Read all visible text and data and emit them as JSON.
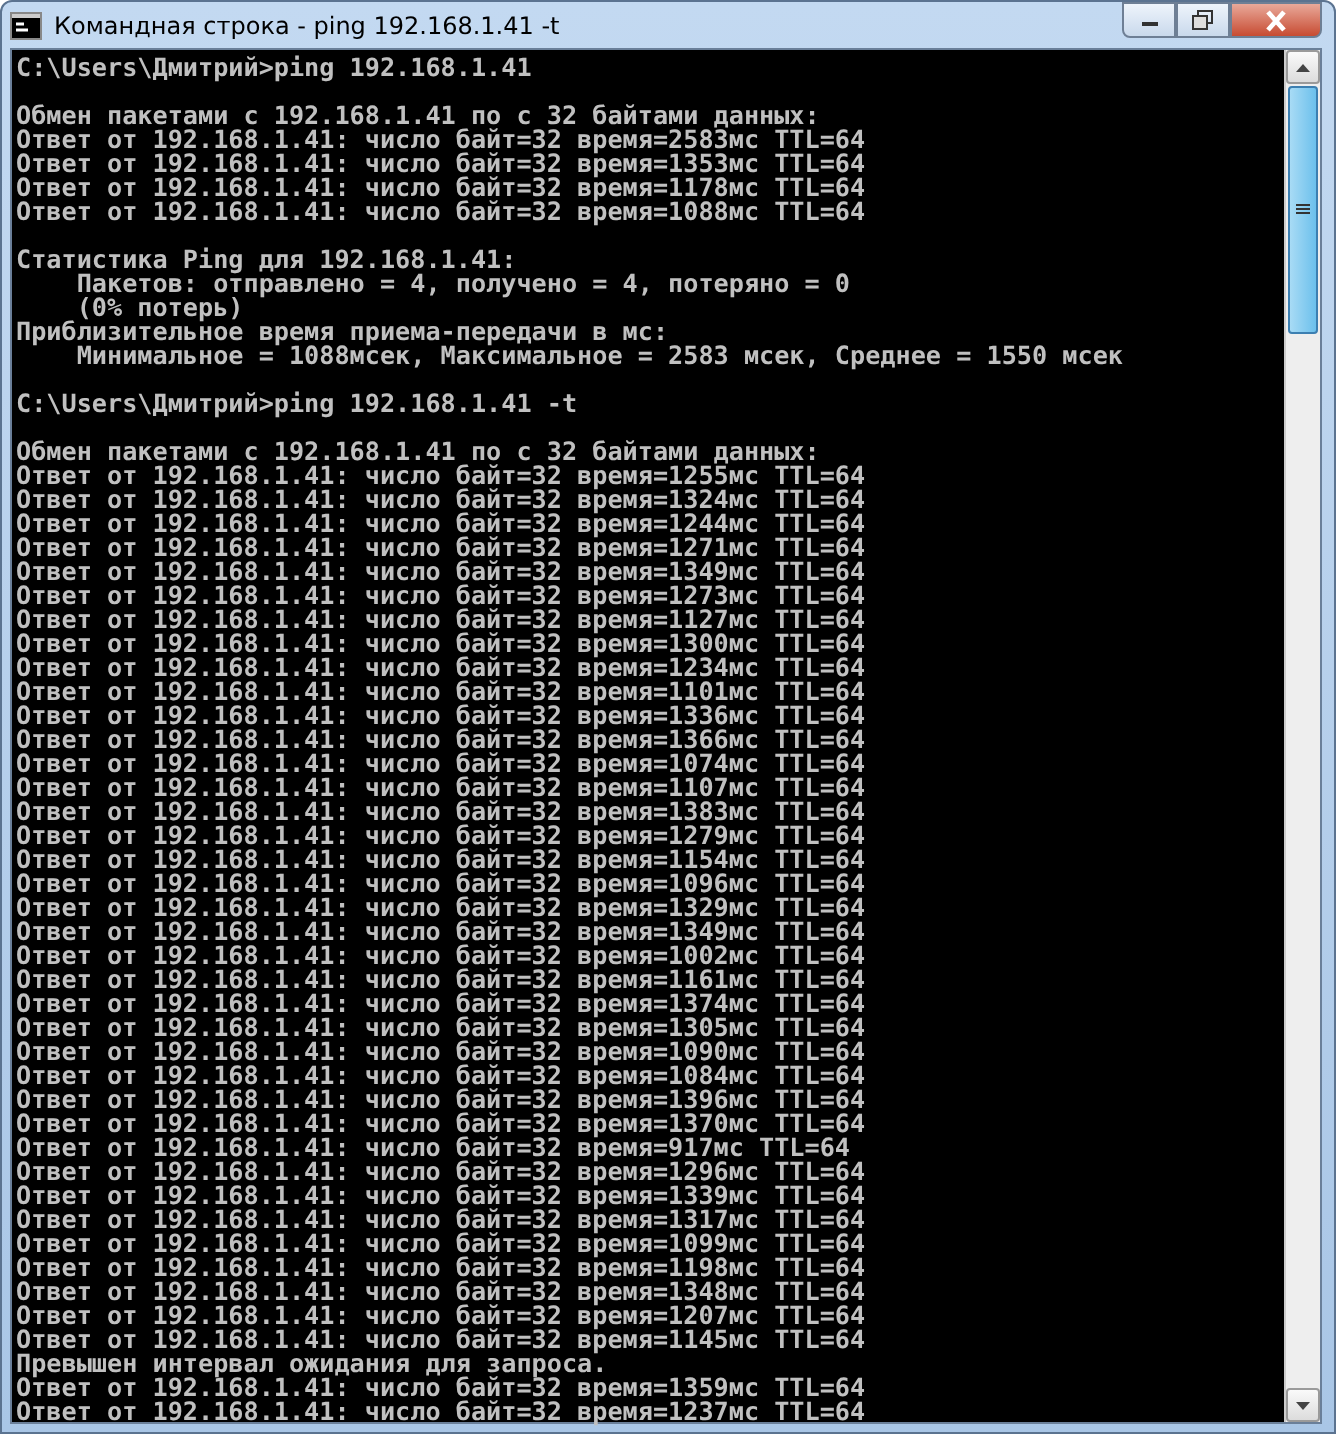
{
  "window": {
    "title": "Командная строка - ping  192.168.1.41 -t"
  },
  "console": {
    "lines": [
      {
        "kind": "text",
        "text": "C:\\Users\\Дмитрий>ping 192.168.1.41"
      },
      {
        "kind": "blank"
      },
      {
        "kind": "text",
        "text": "Обмен пакетами с 192.168.1.41 по с 32 байтами данных:"
      },
      {
        "kind": "text",
        "text": "Ответ от 192.168.1.41: число байт=32 время=2583мс TTL=64"
      },
      {
        "kind": "text",
        "text": "Ответ от 192.168.1.41: число байт=32 время=1353мс TTL=64"
      },
      {
        "kind": "text",
        "text": "Ответ от 192.168.1.41: число байт=32 время=1178мс TTL=64"
      },
      {
        "kind": "text",
        "text": "Ответ от 192.168.1.41: число байт=32 время=1088мс TTL=64"
      },
      {
        "kind": "blank"
      },
      {
        "kind": "text",
        "text": "Статистика Ping для 192.168.1.41:"
      },
      {
        "kind": "text",
        "text": "    Пакетов: отправлено = 4, получено = 4, потеряно = 0"
      },
      {
        "kind": "text",
        "text": "    (0% потерь)"
      },
      {
        "kind": "text",
        "text": "Приблизительное время приема-передачи в мс:"
      },
      {
        "kind": "text",
        "text": "    Минимальное = 1088мсек, Максимальное = 2583 мсек, Среднее = 1550 мсек"
      },
      {
        "kind": "blank"
      },
      {
        "kind": "text",
        "text": "C:\\Users\\Дмитрий>ping 192.168.1.41 -t"
      },
      {
        "kind": "blank"
      },
      {
        "kind": "text",
        "text": "Обмен пакетами с 192.168.1.41 по с 32 байтами данных:"
      },
      {
        "kind": "text",
        "text": "Ответ от 192.168.1.41: число байт=32 время=1255мс TTL=64"
      },
      {
        "kind": "text",
        "text": "Ответ от 192.168.1.41: число байт=32 время=1324мс TTL=64"
      },
      {
        "kind": "text",
        "text": "Ответ от 192.168.1.41: число байт=32 время=1244мс TTL=64"
      },
      {
        "kind": "text",
        "text": "Ответ от 192.168.1.41: число байт=32 время=1271мс TTL=64"
      },
      {
        "kind": "text",
        "text": "Ответ от 192.168.1.41: число байт=32 время=1349мс TTL=64"
      },
      {
        "kind": "text",
        "text": "Ответ от 192.168.1.41: число байт=32 время=1273мс TTL=64"
      },
      {
        "kind": "text",
        "text": "Ответ от 192.168.1.41: число байт=32 время=1127мс TTL=64"
      },
      {
        "kind": "text",
        "text": "Ответ от 192.168.1.41: число байт=32 время=1300мс TTL=64"
      },
      {
        "kind": "text",
        "text": "Ответ от 192.168.1.41: число байт=32 время=1234мс TTL=64"
      },
      {
        "kind": "text",
        "text": "Ответ от 192.168.1.41: число байт=32 время=1101мс TTL=64"
      },
      {
        "kind": "text",
        "text": "Ответ от 192.168.1.41: число байт=32 время=1336мс TTL=64"
      },
      {
        "kind": "text",
        "text": "Ответ от 192.168.1.41: число байт=32 время=1366мс TTL=64"
      },
      {
        "kind": "text",
        "text": "Ответ от 192.168.1.41: число байт=32 время=1074мс TTL=64"
      },
      {
        "kind": "text",
        "text": "Ответ от 192.168.1.41: число байт=32 время=1107мс TTL=64"
      },
      {
        "kind": "text",
        "text": "Ответ от 192.168.1.41: число байт=32 время=1383мс TTL=64"
      },
      {
        "kind": "text",
        "text": "Ответ от 192.168.1.41: число байт=32 время=1279мс TTL=64"
      },
      {
        "kind": "text",
        "text": "Ответ от 192.168.1.41: число байт=32 время=1154мс TTL=64"
      },
      {
        "kind": "text",
        "text": "Ответ от 192.168.1.41: число байт=32 время=1096мс TTL=64"
      },
      {
        "kind": "text",
        "text": "Ответ от 192.168.1.41: число байт=32 время=1329мс TTL=64"
      },
      {
        "kind": "text",
        "text": "Ответ от 192.168.1.41: число байт=32 время=1349мс TTL=64"
      },
      {
        "kind": "text",
        "text": "Ответ от 192.168.1.41: число байт=32 время=1002мс TTL=64"
      },
      {
        "kind": "text",
        "text": "Ответ от 192.168.1.41: число байт=32 время=1161мс TTL=64"
      },
      {
        "kind": "text",
        "text": "Ответ от 192.168.1.41: число байт=32 время=1374мс TTL=64"
      },
      {
        "kind": "text",
        "text": "Ответ от 192.168.1.41: число байт=32 время=1305мс TTL=64"
      },
      {
        "kind": "text",
        "text": "Ответ от 192.168.1.41: число байт=32 время=1090мс TTL=64"
      },
      {
        "kind": "text",
        "text": "Ответ от 192.168.1.41: число байт=32 время=1084мс TTL=64"
      },
      {
        "kind": "text",
        "text": "Ответ от 192.168.1.41: число байт=32 время=1396мс TTL=64"
      },
      {
        "kind": "text",
        "text": "Ответ от 192.168.1.41: число байт=32 время=1370мс TTL=64"
      },
      {
        "kind": "text",
        "text": "Ответ от 192.168.1.41: число байт=32 время=917мс TTL=64"
      },
      {
        "kind": "text",
        "text": "Ответ от 192.168.1.41: число байт=32 время=1296мс TTL=64"
      },
      {
        "kind": "text",
        "text": "Ответ от 192.168.1.41: число байт=32 время=1339мс TTL=64"
      },
      {
        "kind": "text",
        "text": "Ответ от 192.168.1.41: число байт=32 время=1317мс TTL=64"
      },
      {
        "kind": "text",
        "text": "Ответ от 192.168.1.41: число байт=32 время=1099мс TTL=64"
      },
      {
        "kind": "text",
        "text": "Ответ от 192.168.1.41: число байт=32 время=1198мс TTL=64"
      },
      {
        "kind": "text",
        "text": "Ответ от 192.168.1.41: число байт=32 время=1348мс TTL=64"
      },
      {
        "kind": "text",
        "text": "Ответ от 192.168.1.41: число байт=32 время=1207мс TTL=64"
      },
      {
        "kind": "text",
        "text": "Ответ от 192.168.1.41: число байт=32 время=1145мс TTL=64"
      },
      {
        "kind": "text",
        "text": "Превышен интервал ожидания для запроса."
      },
      {
        "kind": "text",
        "text": "Ответ от 192.168.1.41: число байт=32 время=1359мс TTL=64"
      },
      {
        "kind": "text",
        "text": "Ответ от 192.168.1.41: число байт=32 время=1237мс TTL=64"
      }
    ]
  }
}
